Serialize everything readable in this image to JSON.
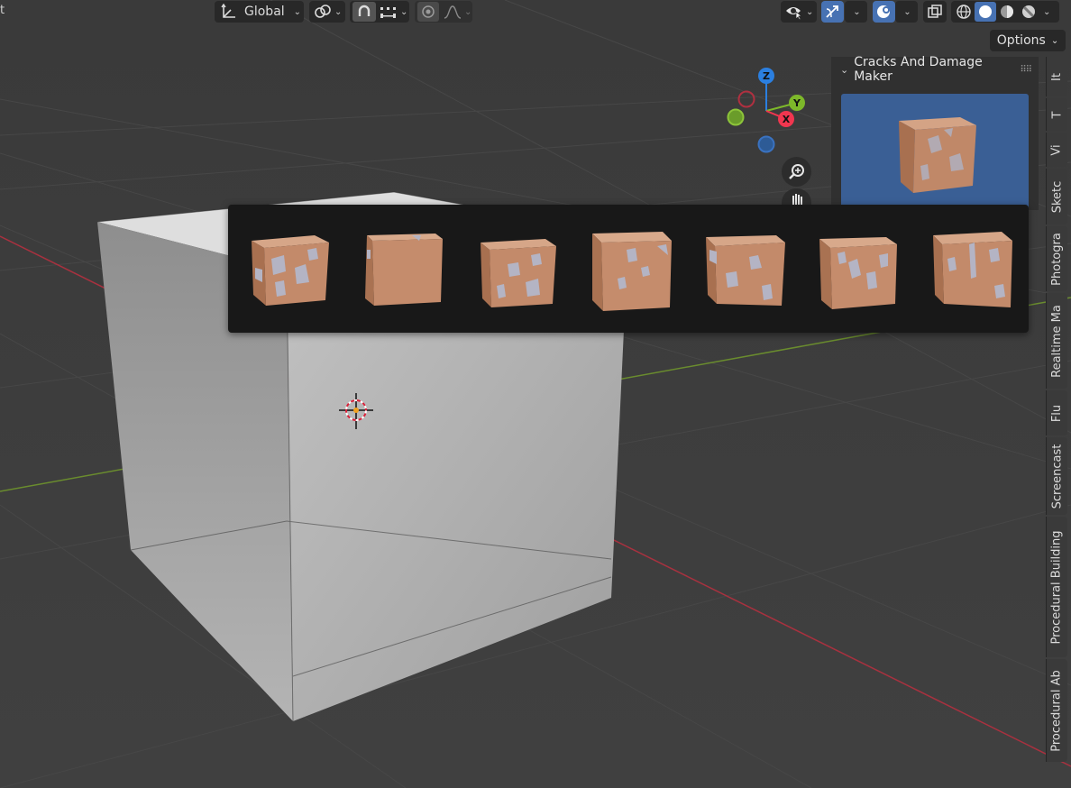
{
  "toolbar": {
    "transform_orientation": "Global",
    "options_label": "Options"
  },
  "top_left_fragment": "t",
  "gizmo": {
    "z_label": "Z",
    "y_label": "Y",
    "x_label": "X"
  },
  "panel": {
    "title": "Cracks And Damage Maker"
  },
  "sidebar_tabs": [
    "It",
    "T",
    "Vi",
    "Sketc",
    "Photogra",
    "Realtime Ma",
    "Flu",
    "Screencast",
    "Procedural Building",
    "Procedural Ab"
  ],
  "popup": {
    "thumbnails": [
      "cracked-cube-1",
      "cracked-cube-2",
      "cracked-cube-3",
      "cracked-cube-4",
      "cracked-cube-5",
      "cracked-cube-6",
      "cracked-cube-7"
    ]
  },
  "colors": {
    "viewport_bg": "#3d3d3d",
    "accent_blue": "#4772b3",
    "axis_x": "#f0364f",
    "axis_y": "#7db82a",
    "axis_z": "#2b7fe0",
    "preview_bg": "#3a5f95",
    "clay": "#c08868"
  }
}
